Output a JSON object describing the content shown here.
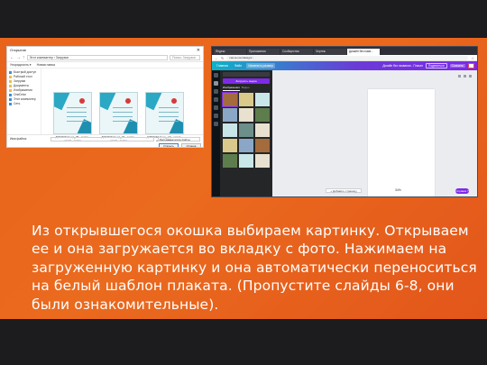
{
  "slide": {
    "caption": "Из открывшегося окошка выбираем картинку. Открываем ее и она загружается во вкладку с фото. Нажимаем на загруженную картинку и она автоматически переноситься на белый шаблон плаката. (Пропустите слайды 6-8, они были ознакомительные)."
  },
  "file_dialog": {
    "title": "Открытие",
    "path": "Этот компьютер › Загрузки",
    "search_placeholder": "Поиск: Загрузки",
    "toolbar": [
      "Упорядочить ▾",
      "Новая папка"
    ],
    "sidebar_items": [
      {
        "label": "Быстрый доступ",
        "type": "star"
      },
      {
        "label": "Рабочий стол",
        "type": "folder"
      },
      {
        "label": "Загрузки",
        "type": "folder"
      },
      {
        "label": "Документы",
        "type": "folder"
      },
      {
        "label": "Изображения",
        "type": "folder"
      },
      {
        "label": "OneDrive",
        "type": "cloud"
      },
      {
        "label": "Этот компьютер",
        "type": "pc"
      },
      {
        "label": "Сеть",
        "type": "net"
      }
    ],
    "files": [
      {
        "caption": "ДИПЛОМ Колд_08 - копия - копия - копия"
      },
      {
        "caption": "ДИПЛОМ Колд_07 - копия - копия - копия"
      },
      {
        "caption": "ДИПЛОМ Колд_ (7) - копия - копия - копия"
      }
    ],
    "filename_label": "Имя файла:",
    "filetype": "Пользовательские файлы",
    "open_button": "Открыть",
    "cancel_button": "Отмена"
  },
  "browser": {
    "tabs": [
      {
        "label": "Яндекс",
        "active": false
      },
      {
        "label": "Приложения",
        "active": false
      },
      {
        "label": "Сообщества",
        "active": false
      },
      {
        "label": "Чертеж",
        "active": false
      },
      {
        "label": "Дизайн без назв...",
        "active": true
      }
    ],
    "url": "canva.com/design/...",
    "editor_menu": [
      "Главная",
      "Файл",
      "Изменить размер"
    ],
    "design_title": "Дизайн без названия - Плакат",
    "share_button": "Поделиться",
    "download_button": "Скачать",
    "panel_upload_button": "Загрузить медиа",
    "panel_tabs": [
      "Изображения",
      "Видео"
    ],
    "add_page_button": "+ Добавить страницу",
    "zoom": "34%",
    "help_button": "Справка ?"
  }
}
